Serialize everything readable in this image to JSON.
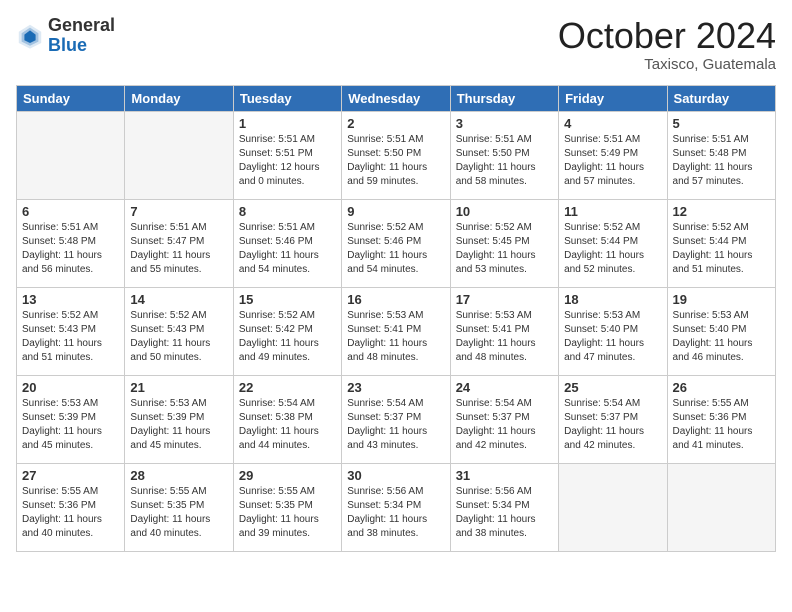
{
  "header": {
    "logo_general": "General",
    "logo_blue": "Blue",
    "month": "October 2024",
    "location": "Taxisco, Guatemala"
  },
  "days_of_week": [
    "Sunday",
    "Monday",
    "Tuesday",
    "Wednesday",
    "Thursday",
    "Friday",
    "Saturday"
  ],
  "weeks": [
    [
      {
        "day": "",
        "text": ""
      },
      {
        "day": "",
        "text": ""
      },
      {
        "day": "1",
        "text": "Sunrise: 5:51 AM\nSunset: 5:51 PM\nDaylight: 12 hours\nand 0 minutes."
      },
      {
        "day": "2",
        "text": "Sunrise: 5:51 AM\nSunset: 5:50 PM\nDaylight: 11 hours\nand 59 minutes."
      },
      {
        "day": "3",
        "text": "Sunrise: 5:51 AM\nSunset: 5:50 PM\nDaylight: 11 hours\nand 58 minutes."
      },
      {
        "day": "4",
        "text": "Sunrise: 5:51 AM\nSunset: 5:49 PM\nDaylight: 11 hours\nand 57 minutes."
      },
      {
        "day": "5",
        "text": "Sunrise: 5:51 AM\nSunset: 5:48 PM\nDaylight: 11 hours\nand 57 minutes."
      }
    ],
    [
      {
        "day": "6",
        "text": "Sunrise: 5:51 AM\nSunset: 5:48 PM\nDaylight: 11 hours\nand 56 minutes."
      },
      {
        "day": "7",
        "text": "Sunrise: 5:51 AM\nSunset: 5:47 PM\nDaylight: 11 hours\nand 55 minutes."
      },
      {
        "day": "8",
        "text": "Sunrise: 5:51 AM\nSunset: 5:46 PM\nDaylight: 11 hours\nand 54 minutes."
      },
      {
        "day": "9",
        "text": "Sunrise: 5:52 AM\nSunset: 5:46 PM\nDaylight: 11 hours\nand 54 minutes."
      },
      {
        "day": "10",
        "text": "Sunrise: 5:52 AM\nSunset: 5:45 PM\nDaylight: 11 hours\nand 53 minutes."
      },
      {
        "day": "11",
        "text": "Sunrise: 5:52 AM\nSunset: 5:44 PM\nDaylight: 11 hours\nand 52 minutes."
      },
      {
        "day": "12",
        "text": "Sunrise: 5:52 AM\nSunset: 5:44 PM\nDaylight: 11 hours\nand 51 minutes."
      }
    ],
    [
      {
        "day": "13",
        "text": "Sunrise: 5:52 AM\nSunset: 5:43 PM\nDaylight: 11 hours\nand 51 minutes."
      },
      {
        "day": "14",
        "text": "Sunrise: 5:52 AM\nSunset: 5:43 PM\nDaylight: 11 hours\nand 50 minutes."
      },
      {
        "day": "15",
        "text": "Sunrise: 5:52 AM\nSunset: 5:42 PM\nDaylight: 11 hours\nand 49 minutes."
      },
      {
        "day": "16",
        "text": "Sunrise: 5:53 AM\nSunset: 5:41 PM\nDaylight: 11 hours\nand 48 minutes."
      },
      {
        "day": "17",
        "text": "Sunrise: 5:53 AM\nSunset: 5:41 PM\nDaylight: 11 hours\nand 48 minutes."
      },
      {
        "day": "18",
        "text": "Sunrise: 5:53 AM\nSunset: 5:40 PM\nDaylight: 11 hours\nand 47 minutes."
      },
      {
        "day": "19",
        "text": "Sunrise: 5:53 AM\nSunset: 5:40 PM\nDaylight: 11 hours\nand 46 minutes."
      }
    ],
    [
      {
        "day": "20",
        "text": "Sunrise: 5:53 AM\nSunset: 5:39 PM\nDaylight: 11 hours\nand 45 minutes."
      },
      {
        "day": "21",
        "text": "Sunrise: 5:53 AM\nSunset: 5:39 PM\nDaylight: 11 hours\nand 45 minutes."
      },
      {
        "day": "22",
        "text": "Sunrise: 5:54 AM\nSunset: 5:38 PM\nDaylight: 11 hours\nand 44 minutes."
      },
      {
        "day": "23",
        "text": "Sunrise: 5:54 AM\nSunset: 5:37 PM\nDaylight: 11 hours\nand 43 minutes."
      },
      {
        "day": "24",
        "text": "Sunrise: 5:54 AM\nSunset: 5:37 PM\nDaylight: 11 hours\nand 42 minutes."
      },
      {
        "day": "25",
        "text": "Sunrise: 5:54 AM\nSunset: 5:37 PM\nDaylight: 11 hours\nand 42 minutes."
      },
      {
        "day": "26",
        "text": "Sunrise: 5:55 AM\nSunset: 5:36 PM\nDaylight: 11 hours\nand 41 minutes."
      }
    ],
    [
      {
        "day": "27",
        "text": "Sunrise: 5:55 AM\nSunset: 5:36 PM\nDaylight: 11 hours\nand 40 minutes."
      },
      {
        "day": "28",
        "text": "Sunrise: 5:55 AM\nSunset: 5:35 PM\nDaylight: 11 hours\nand 40 minutes."
      },
      {
        "day": "29",
        "text": "Sunrise: 5:55 AM\nSunset: 5:35 PM\nDaylight: 11 hours\nand 39 minutes."
      },
      {
        "day": "30",
        "text": "Sunrise: 5:56 AM\nSunset: 5:34 PM\nDaylight: 11 hours\nand 38 minutes."
      },
      {
        "day": "31",
        "text": "Sunrise: 5:56 AM\nSunset: 5:34 PM\nDaylight: 11 hours\nand 38 minutes."
      },
      {
        "day": "",
        "text": ""
      },
      {
        "day": "",
        "text": ""
      }
    ]
  ]
}
